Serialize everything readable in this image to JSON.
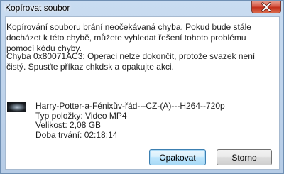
{
  "window": {
    "title": "Kopírovat soubor",
    "close_icon": "close-icon"
  },
  "message": {
    "line1": "Kopírování souboru brání neočekávaná chyba. Pokud bude stále docházet k této chybě, můžete vyhledat řešení tohoto problému pomocí kódu chyby.",
    "line2": "Chyba 0x80071AC3: Operaci nelze dokončit, protože svazek není čistý. Spusťte příkaz chkdsk a opakujte akci."
  },
  "file": {
    "name": "Harry-Potter-a-Fénixův-řád---CZ-(A)---H264--720p",
    "type": "Typ položky: Video MP4",
    "size": "Velikost: 2,08 GB",
    "duration": "Doba trvání: 02:18:14",
    "thumbnail": "video-thumbnail"
  },
  "buttons": {
    "retry": "Opakovat",
    "cancel": "Storno"
  }
}
